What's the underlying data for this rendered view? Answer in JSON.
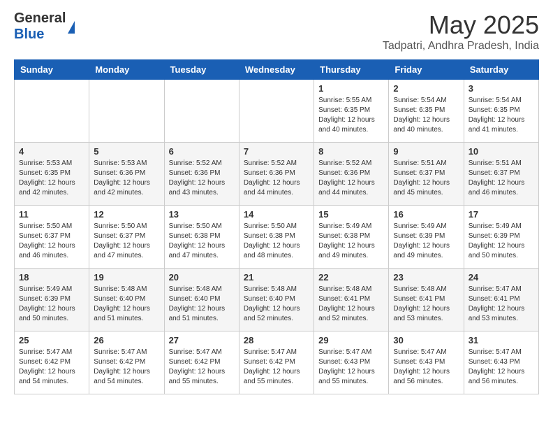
{
  "logo": {
    "general": "General",
    "blue": "Blue"
  },
  "header": {
    "month_year": "May 2025",
    "location": "Tadpatri, Andhra Pradesh, India"
  },
  "days_of_week": [
    "Sunday",
    "Monday",
    "Tuesday",
    "Wednesday",
    "Thursday",
    "Friday",
    "Saturday"
  ],
  "weeks": [
    [
      {
        "day": "",
        "info": ""
      },
      {
        "day": "",
        "info": ""
      },
      {
        "day": "",
        "info": ""
      },
      {
        "day": "",
        "info": ""
      },
      {
        "day": "1",
        "info": "Sunrise: 5:55 AM\nSunset: 6:35 PM\nDaylight: 12 hours\nand 40 minutes."
      },
      {
        "day": "2",
        "info": "Sunrise: 5:54 AM\nSunset: 6:35 PM\nDaylight: 12 hours\nand 40 minutes."
      },
      {
        "day": "3",
        "info": "Sunrise: 5:54 AM\nSunset: 6:35 PM\nDaylight: 12 hours\nand 41 minutes."
      }
    ],
    [
      {
        "day": "4",
        "info": "Sunrise: 5:53 AM\nSunset: 6:35 PM\nDaylight: 12 hours\nand 42 minutes."
      },
      {
        "day": "5",
        "info": "Sunrise: 5:53 AM\nSunset: 6:36 PM\nDaylight: 12 hours\nand 42 minutes."
      },
      {
        "day": "6",
        "info": "Sunrise: 5:52 AM\nSunset: 6:36 PM\nDaylight: 12 hours\nand 43 minutes."
      },
      {
        "day": "7",
        "info": "Sunrise: 5:52 AM\nSunset: 6:36 PM\nDaylight: 12 hours\nand 44 minutes."
      },
      {
        "day": "8",
        "info": "Sunrise: 5:52 AM\nSunset: 6:36 PM\nDaylight: 12 hours\nand 44 minutes."
      },
      {
        "day": "9",
        "info": "Sunrise: 5:51 AM\nSunset: 6:37 PM\nDaylight: 12 hours\nand 45 minutes."
      },
      {
        "day": "10",
        "info": "Sunrise: 5:51 AM\nSunset: 6:37 PM\nDaylight: 12 hours\nand 46 minutes."
      }
    ],
    [
      {
        "day": "11",
        "info": "Sunrise: 5:50 AM\nSunset: 6:37 PM\nDaylight: 12 hours\nand 46 minutes."
      },
      {
        "day": "12",
        "info": "Sunrise: 5:50 AM\nSunset: 6:37 PM\nDaylight: 12 hours\nand 47 minutes."
      },
      {
        "day": "13",
        "info": "Sunrise: 5:50 AM\nSunset: 6:38 PM\nDaylight: 12 hours\nand 47 minutes."
      },
      {
        "day": "14",
        "info": "Sunrise: 5:50 AM\nSunset: 6:38 PM\nDaylight: 12 hours\nand 48 minutes."
      },
      {
        "day": "15",
        "info": "Sunrise: 5:49 AM\nSunset: 6:38 PM\nDaylight: 12 hours\nand 49 minutes."
      },
      {
        "day": "16",
        "info": "Sunrise: 5:49 AM\nSunset: 6:39 PM\nDaylight: 12 hours\nand 49 minutes."
      },
      {
        "day": "17",
        "info": "Sunrise: 5:49 AM\nSunset: 6:39 PM\nDaylight: 12 hours\nand 50 minutes."
      }
    ],
    [
      {
        "day": "18",
        "info": "Sunrise: 5:49 AM\nSunset: 6:39 PM\nDaylight: 12 hours\nand 50 minutes."
      },
      {
        "day": "19",
        "info": "Sunrise: 5:48 AM\nSunset: 6:40 PM\nDaylight: 12 hours\nand 51 minutes."
      },
      {
        "day": "20",
        "info": "Sunrise: 5:48 AM\nSunset: 6:40 PM\nDaylight: 12 hours\nand 51 minutes."
      },
      {
        "day": "21",
        "info": "Sunrise: 5:48 AM\nSunset: 6:40 PM\nDaylight: 12 hours\nand 52 minutes."
      },
      {
        "day": "22",
        "info": "Sunrise: 5:48 AM\nSunset: 6:41 PM\nDaylight: 12 hours\nand 52 minutes."
      },
      {
        "day": "23",
        "info": "Sunrise: 5:48 AM\nSunset: 6:41 PM\nDaylight: 12 hours\nand 53 minutes."
      },
      {
        "day": "24",
        "info": "Sunrise: 5:47 AM\nSunset: 6:41 PM\nDaylight: 12 hours\nand 53 minutes."
      }
    ],
    [
      {
        "day": "25",
        "info": "Sunrise: 5:47 AM\nSunset: 6:42 PM\nDaylight: 12 hours\nand 54 minutes."
      },
      {
        "day": "26",
        "info": "Sunrise: 5:47 AM\nSunset: 6:42 PM\nDaylight: 12 hours\nand 54 minutes."
      },
      {
        "day": "27",
        "info": "Sunrise: 5:47 AM\nSunset: 6:42 PM\nDaylight: 12 hours\nand 55 minutes."
      },
      {
        "day": "28",
        "info": "Sunrise: 5:47 AM\nSunset: 6:42 PM\nDaylight: 12 hours\nand 55 minutes."
      },
      {
        "day": "29",
        "info": "Sunrise: 5:47 AM\nSunset: 6:43 PM\nDaylight: 12 hours\nand 55 minutes."
      },
      {
        "day": "30",
        "info": "Sunrise: 5:47 AM\nSunset: 6:43 PM\nDaylight: 12 hours\nand 56 minutes."
      },
      {
        "day": "31",
        "info": "Sunrise: 5:47 AM\nSunset: 6:43 PM\nDaylight: 12 hours\nand 56 minutes."
      }
    ]
  ]
}
